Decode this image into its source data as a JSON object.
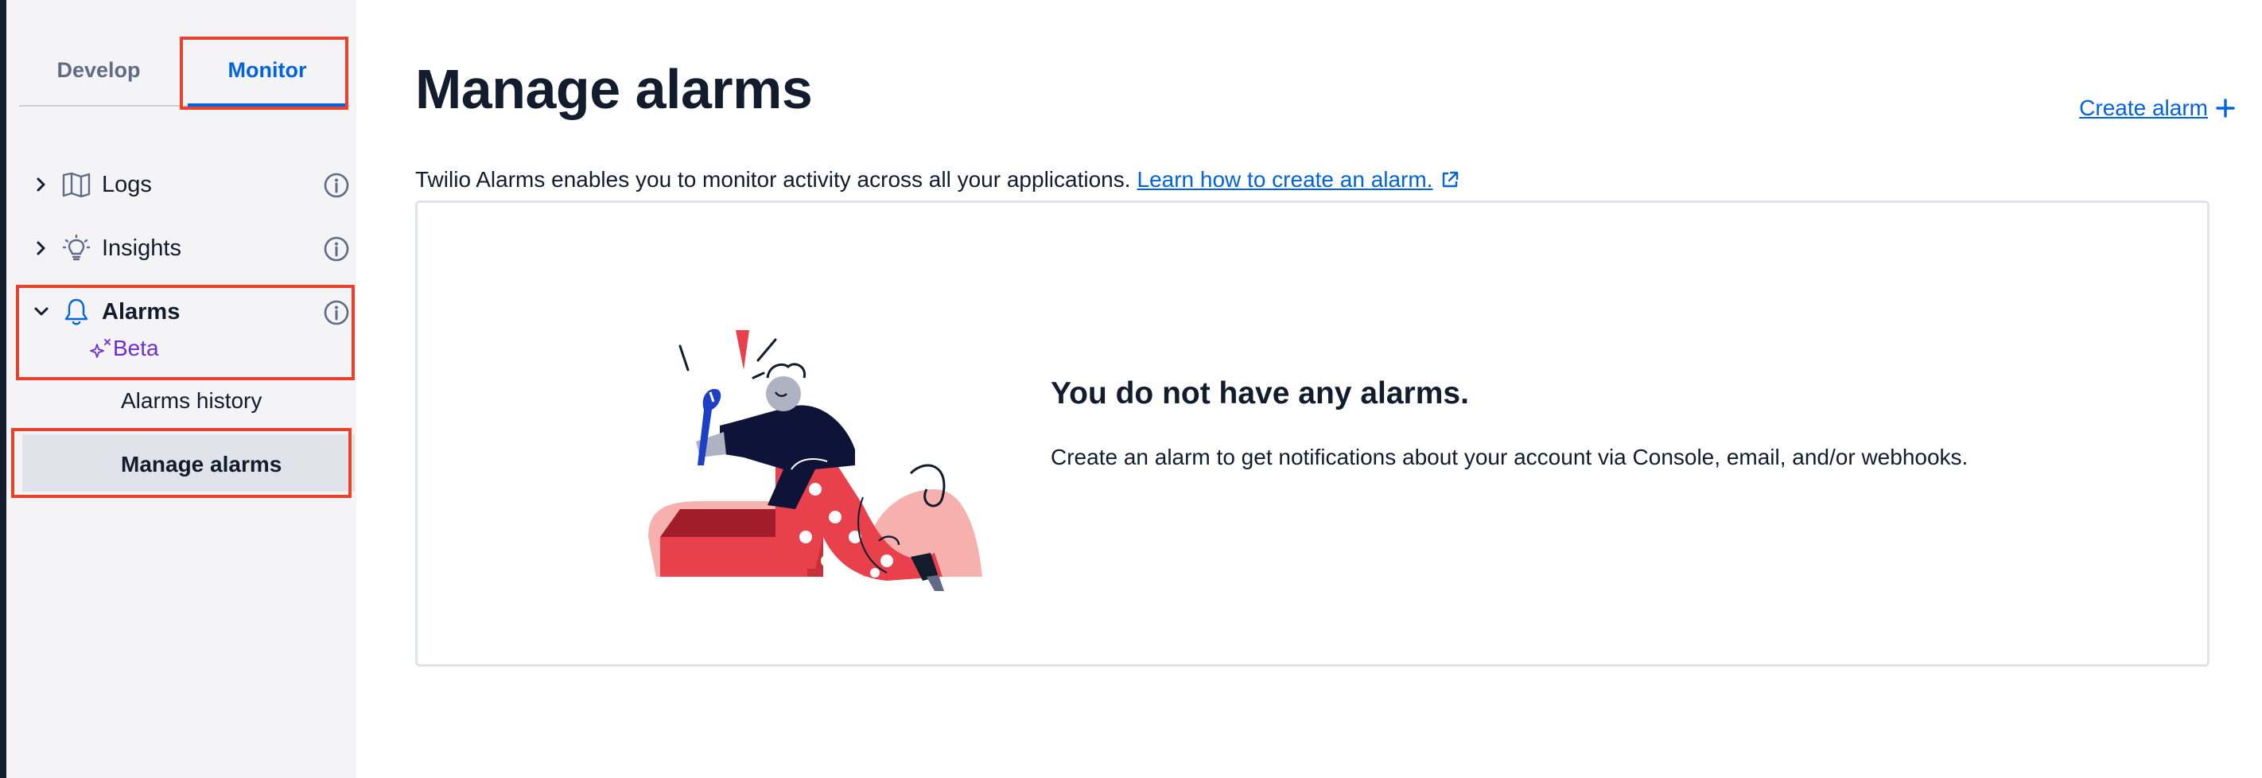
{
  "sidebar": {
    "tabs": [
      {
        "label": "Develop",
        "active": false
      },
      {
        "label": "Monitor",
        "active": true
      }
    ],
    "items": [
      {
        "label": "Logs",
        "icon": "book-icon",
        "expanded": false
      },
      {
        "label": "Insights",
        "icon": "lightbulb-icon",
        "expanded": false
      },
      {
        "label": "Alarms",
        "icon": "bell-icon",
        "expanded": true,
        "badge": "Beta"
      }
    ],
    "subitems": [
      {
        "label": "Alarms history",
        "active": false
      },
      {
        "label": "Manage alarms",
        "active": true
      }
    ]
  },
  "main": {
    "title": "Manage alarms",
    "create_link": "Create alarm",
    "description": "Twilio Alarms enables you to monitor activity across all your applications.",
    "learn_link": "Learn how to create an alarm.",
    "empty_state": {
      "title": "You do not have any alarms.",
      "text": "Create an alarm to get notifications about your account via Console, email, and/or webhooks."
    }
  },
  "colors": {
    "accent": "#0263e0",
    "highlight": "#e8412c",
    "beta": "#6d2ed1",
    "sidebar_bg": "#f4f4f6"
  }
}
